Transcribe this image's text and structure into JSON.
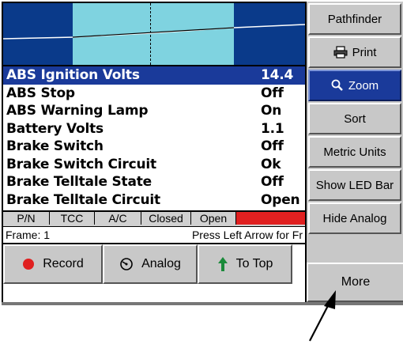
{
  "graph": {
    "icons": [
      "trace-line",
      "cursor"
    ]
  },
  "params": [
    {
      "name": "ABS Ignition Volts",
      "value": "14.4",
      "selected": true
    },
    {
      "name": "ABS Stop",
      "value": "Off",
      "selected": false
    },
    {
      "name": "ABS Warning Lamp",
      "value": "On",
      "selected": false
    },
    {
      "name": "Battery Volts",
      "value": "1.1",
      "selected": false
    },
    {
      "name": "Brake Switch",
      "value": "Off",
      "selected": false
    },
    {
      "name": "Brake Switch Circuit",
      "value": "Ok",
      "selected": false
    },
    {
      "name": "Brake Telltale State",
      "value": "Off",
      "selected": false
    },
    {
      "name": "Brake Telltale Circuit",
      "value": "Open",
      "selected": false
    }
  ],
  "status_bar": {
    "cells": [
      "P/N",
      "TCC",
      "A/C",
      "Closed",
      "Open"
    ],
    "indicator_color": "#e02020"
  },
  "frame_line": {
    "frame": "Frame: 1",
    "hint": "Press Left Arrow for Fr"
  },
  "bottom_buttons": {
    "record": "Record",
    "analog": "Analog",
    "to_top": "To Top",
    "more": "More"
  },
  "side_buttons": {
    "pathfinder": "Pathfinder",
    "print": "Print",
    "zoom": "Zoom",
    "sort": "Sort",
    "metric_units": "Metric Units",
    "show_led_bar": "Show LED Bar",
    "hide_analog": "Hide Analog"
  },
  "colors": {
    "selection": "#1a3a9a",
    "graph_bg": "#0a3a8a",
    "graph_window": "#7fd3e0",
    "record_dot": "#e02020",
    "to_top_arrow": "#1a8a3a"
  }
}
